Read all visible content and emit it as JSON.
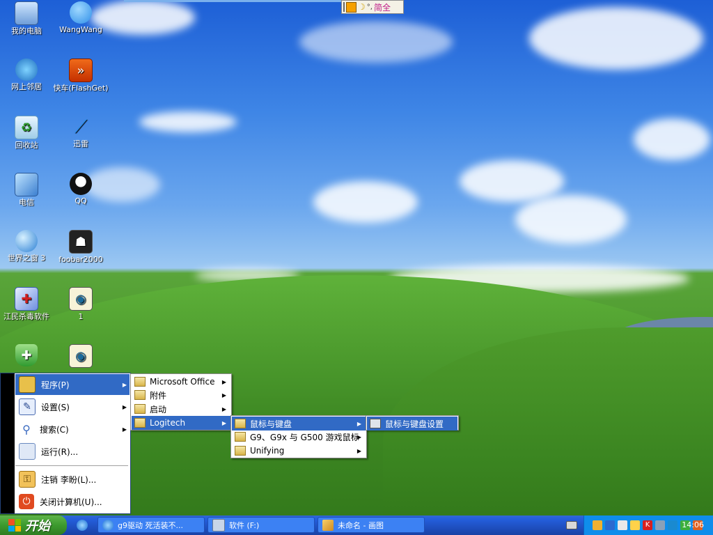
{
  "desktop": {
    "icons": [
      {
        "label": "我的电脑",
        "icon": "my-computer-icon"
      },
      {
        "label": "WangWang",
        "icon": "wangwang-icon"
      },
      {
        "label": "网上邻居",
        "icon": "network-places-icon"
      },
      {
        "label": "快车(FlashGet)",
        "icon": "flashget-icon"
      },
      {
        "label": "回收站",
        "icon": "recycle-bin-icon"
      },
      {
        "label": "迅雷",
        "icon": "xunlei-icon"
      },
      {
        "label": "电信",
        "icon": "telecom-icon"
      },
      {
        "label": "QQ",
        "icon": "qq-icon"
      },
      {
        "label": "世界之窗 3",
        "icon": "theworld-browser-icon"
      },
      {
        "label": "foobar2000",
        "icon": "foobar2000-icon"
      },
      {
        "label": "江民杀毒软件",
        "icon": "jiangmin-antivirus-icon"
      },
      {
        "label": "1",
        "icon": "image-file-icon"
      }
    ]
  },
  "ime_bar": {
    "text": "简全",
    "icon": "ime-toolbar-icon"
  },
  "start_menu": {
    "items": [
      {
        "label": "程序(P)",
        "icon": "programs-icon",
        "submenu": true
      },
      {
        "label": "设置(S)",
        "icon": "settings-icon",
        "submenu": true
      },
      {
        "label": "搜索(C)",
        "icon": "search-icon",
        "submenu": true
      },
      {
        "label": "运行(R)...",
        "icon": "run-icon",
        "submenu": false
      },
      {
        "label": "注销 李盼(L)...",
        "icon": "logoff-icon",
        "submenu": false
      },
      {
        "label": "关闭计算机(U)...",
        "icon": "shutdown-icon",
        "submenu": false
      }
    ]
  },
  "programs_menu": {
    "items": [
      "Microsoft Office",
      "附件",
      "启动",
      "Logitech"
    ]
  },
  "logitech_menu": {
    "items": [
      "鼠标与键盘",
      "G9、G9x 与 G500 游戏鼠标",
      "Unifying"
    ]
  },
  "mouse_keyboard_menu": {
    "items": [
      "鼠标与键盘设置"
    ]
  },
  "taskbar": {
    "start_label": "开始",
    "buttons": [
      "g9驱动 死活装不...",
      "软件 (F:)",
      "未命名 - 画图"
    ],
    "clock": "14:06"
  },
  "colors": {
    "taskbar": "#245edb",
    "start_button": "#3c9a2e",
    "menu_highlight": "#316ac5",
    "tray": "#0f8deb"
  }
}
